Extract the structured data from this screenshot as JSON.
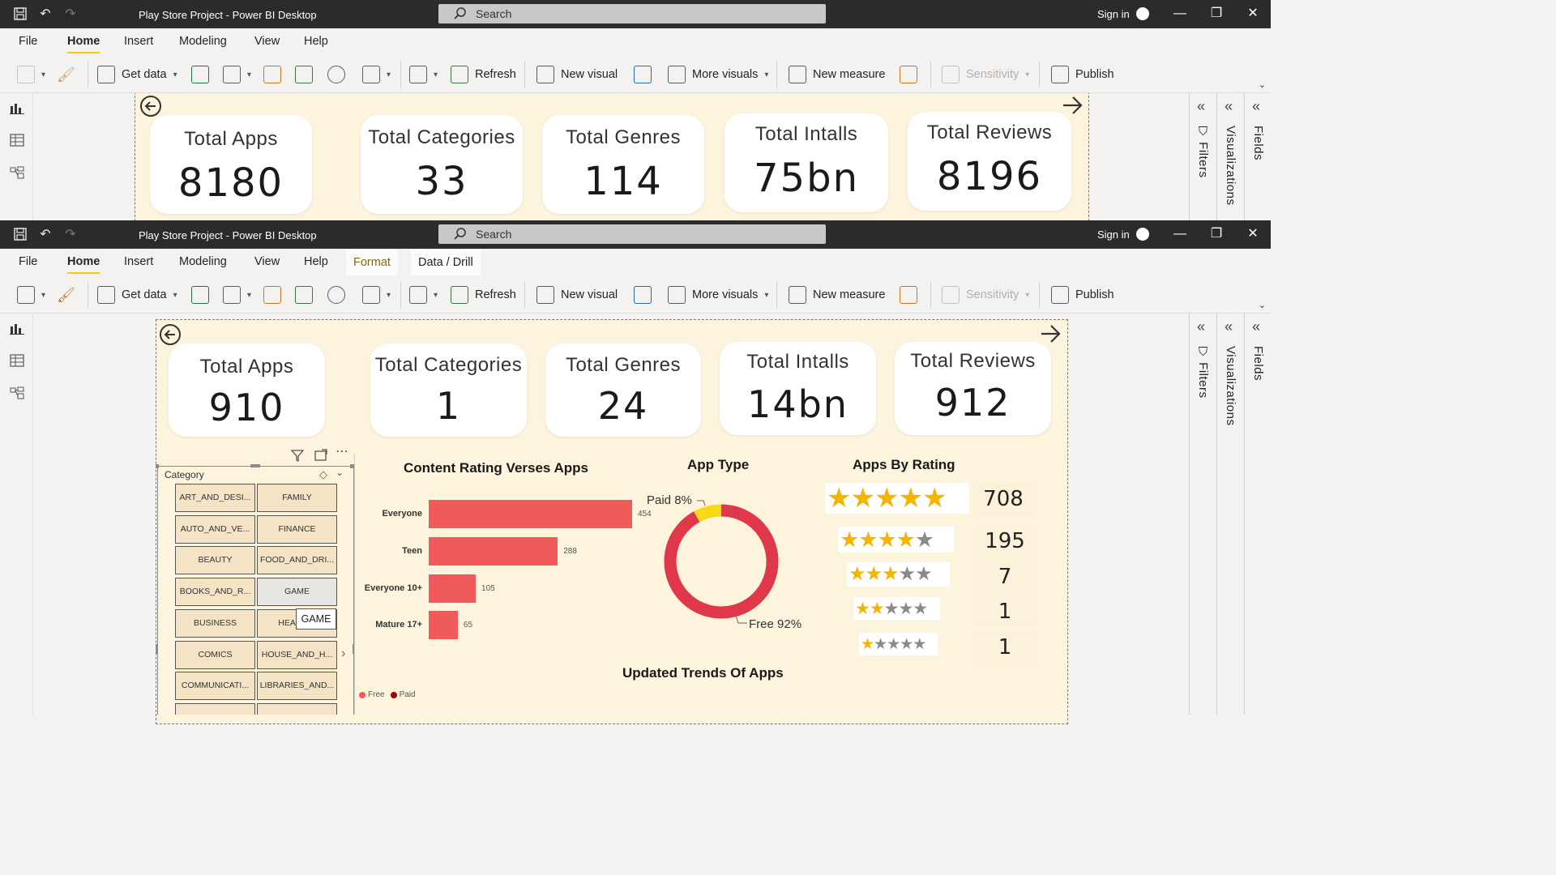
{
  "app": {
    "title": "Play Store Project - Power BI Desktop",
    "search_placeholder": "Search",
    "sign_in": "Sign in"
  },
  "menu": {
    "file": "File",
    "home": "Home",
    "insert": "Insert",
    "modeling": "Modeling",
    "view": "View",
    "help": "Help",
    "format": "Format",
    "data_drill": "Data / Drill"
  },
  "ribbon": {
    "get_data": "Get data",
    "refresh": "Refresh",
    "new_visual": "New visual",
    "more_visuals": "More visuals",
    "new_measure": "New measure",
    "sensitivity": "Sensitivity",
    "publish": "Publish"
  },
  "panes": {
    "filters": "Filters",
    "visualizations": "Visualizations",
    "fields": "Fields"
  },
  "cards_labels": {
    "apps": "Total Apps",
    "categories": "Total Categories",
    "genres": "Total Genres",
    "installs": "Total Intalls",
    "reviews": "Total Reviews"
  },
  "top_cards": {
    "apps": "8180",
    "categories": "33",
    "genres": "114",
    "installs": "75bn",
    "reviews": "8196"
  },
  "bottom_cards": {
    "apps": "910",
    "categories": "1",
    "genres": "24",
    "installs": "14bn",
    "reviews": "912"
  },
  "slicer": {
    "title": "Category",
    "tooltip": "GAME",
    "items": [
      "ART_AND_DESI...",
      "FAMILY",
      "AUTO_AND_VE...",
      "FINANCE",
      "BEAUTY",
      "FOOD_AND_DRI...",
      "BOOKS_AND_R...",
      "GAME",
      "BUSINESS",
      "HEALTH_",
      "COMICS",
      "HOUSE_AND_H...",
      "COMMUNICATI...",
      "LIBRARIES_AND..."
    ]
  },
  "chart_data": [
    {
      "type": "bar",
      "title": "Content Rating Verses Apps",
      "categories": [
        "Everyone",
        "Teen",
        "Everyone 10+",
        "Mature 17+"
      ],
      "values": [
        454,
        288,
        105,
        65
      ],
      "legend": [
        "Free",
        "Paid"
      ],
      "colors": {
        "Free": "#f05a5a",
        "Paid": "#a00000"
      }
    },
    {
      "type": "pie",
      "title": "App Type",
      "categories": [
        "Paid",
        "Free"
      ],
      "values": [
        8,
        92
      ],
      "labels": [
        "Paid 8%",
        "Free 92%"
      ],
      "colors": {
        "Paid": "#f7d917",
        "Free": "#e0384b"
      }
    },
    {
      "type": "table",
      "title": "Apps By Rating",
      "categories": [
        5,
        4,
        3,
        2,
        1
      ],
      "values": [
        708,
        195,
        7,
        1,
        1
      ]
    }
  ],
  "trend_title": "Updated Trends Of Apps",
  "colors": {
    "accent": "#f2c811",
    "report_bg": "#fcf4dc",
    "titlebar": "#2b2b2b",
    "bar": "#f05a5a",
    "star": "#f4b400"
  }
}
